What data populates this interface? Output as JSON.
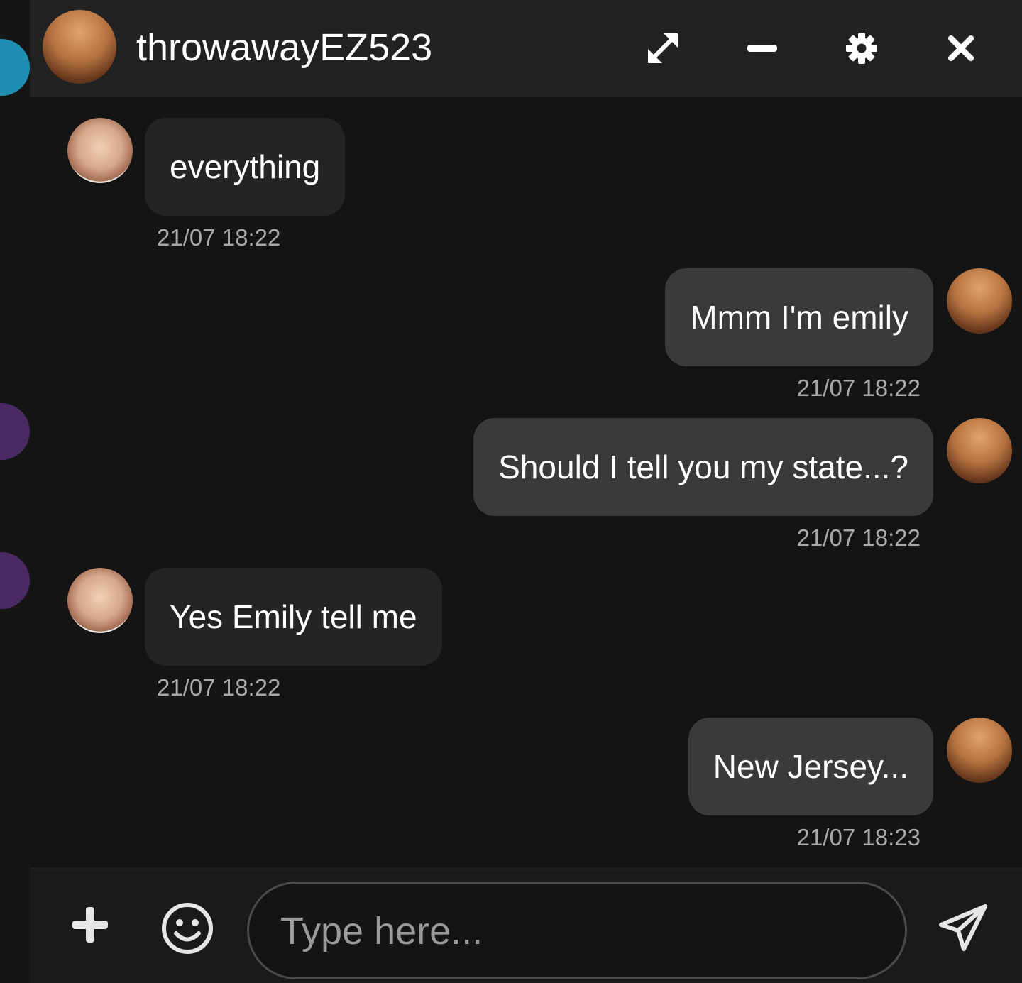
{
  "chat": {
    "title": "throwawayEZ523",
    "header_icons": [
      "expand-icon",
      "minimize-icon",
      "gear-icon",
      "close-icon"
    ]
  },
  "messages": [
    {
      "direction": "incoming",
      "text": "everything",
      "timestamp": "21/07 18:22"
    },
    {
      "direction": "outgoing",
      "text": "Mmm I'm emily",
      "timestamp": "21/07 18:22"
    },
    {
      "direction": "outgoing",
      "text": "Should I tell you my state...?",
      "timestamp": "21/07 18:22"
    },
    {
      "direction": "incoming",
      "text": "Yes Emily tell me",
      "timestamp": "21/07 18:22"
    },
    {
      "direction": "outgoing",
      "text": "New Jersey...",
      "timestamp": "21/07 18:23"
    }
  ],
  "composer": {
    "placeholder": "Type here...",
    "icons": [
      "plus-icon",
      "emoji-icon",
      "send-icon"
    ]
  },
  "colors": {
    "background": "#141414",
    "header": "#222222",
    "incoming_bubble": "#242424",
    "outgoing_bubble": "#3a3a3a",
    "timestamp": "#a9a9a9",
    "text": "#ffffff"
  }
}
